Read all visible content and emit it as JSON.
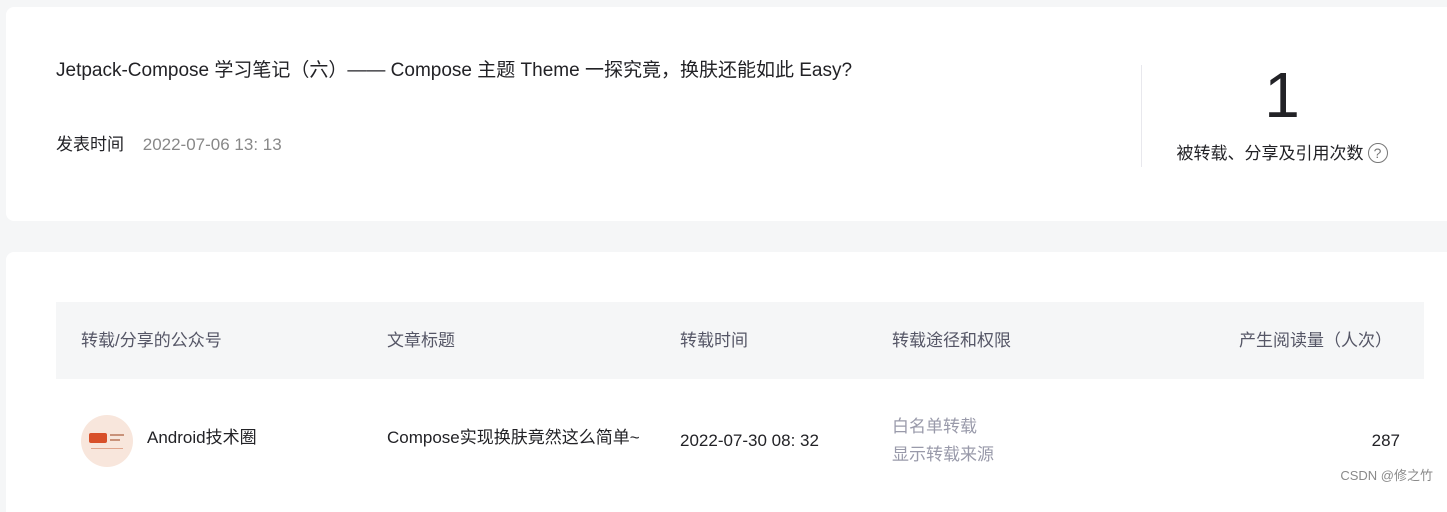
{
  "article": {
    "title": "Jetpack-Compose 学习笔记（六）—— Compose 主题 Theme 一探究竟，换肤还能如此 Easy?",
    "publish_label": "发表时间",
    "publish_time": "2022-07-06 13: 13"
  },
  "stats": {
    "count": "1",
    "label": "被转载、分享及引用次数",
    "help_icon": "question-circle-icon"
  },
  "table": {
    "headers": [
      "转载/分享的公众号",
      "文章标题",
      "转载时间",
      "转载途径和权限",
      "产生阅读量（人次）"
    ],
    "rows": [
      {
        "account": "Android技术圈",
        "article_title": "Compose实现换肤竟然这么简单~",
        "time": "2022-07-30 08: 32",
        "route": [
          "白名单转载",
          "显示转载来源"
        ],
        "reads": "287"
      }
    ]
  },
  "watermark": "CSDN @修之竹"
}
